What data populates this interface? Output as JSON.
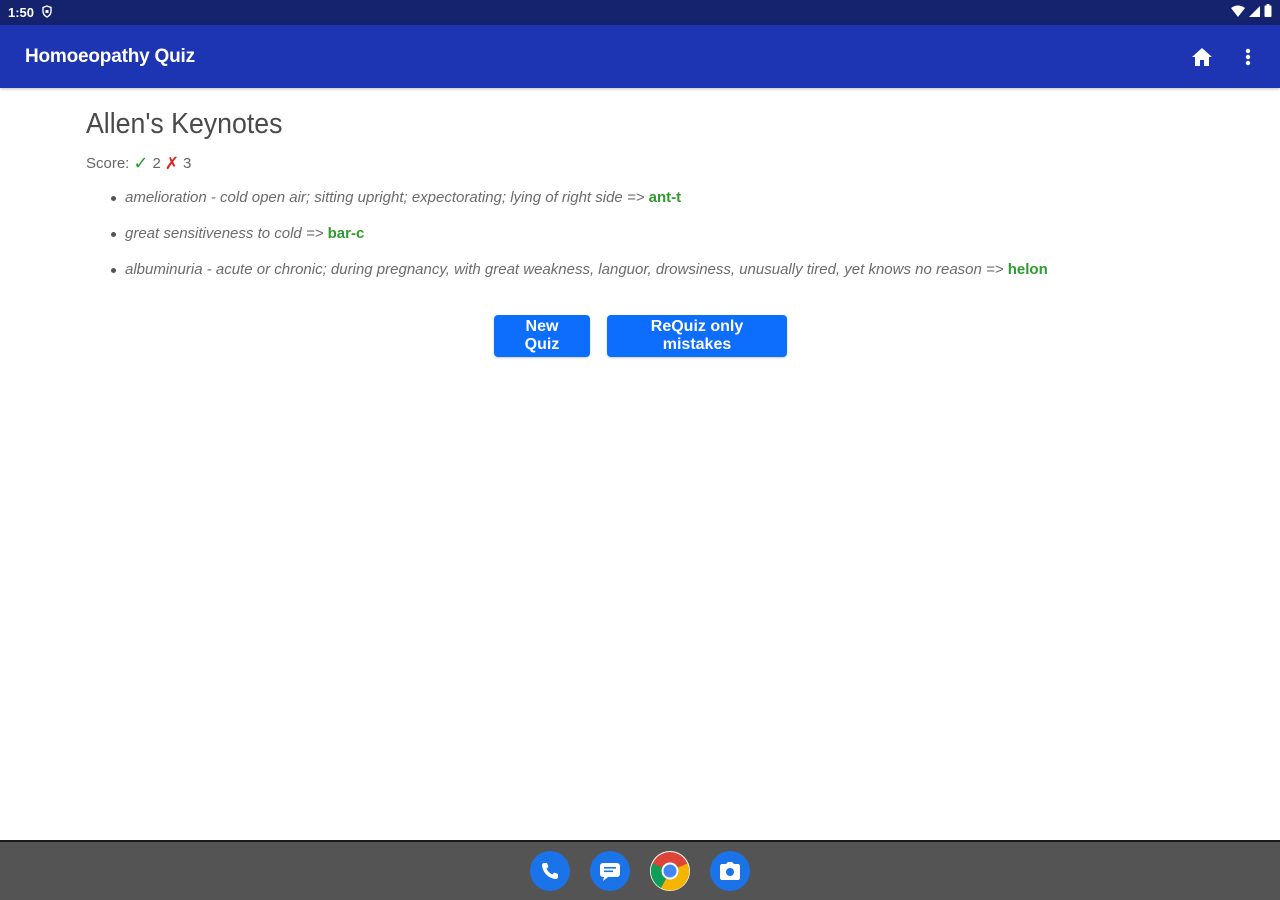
{
  "status_bar": {
    "time": "1:50"
  },
  "app_bar": {
    "title": "Homoeopathy Quiz",
    "home_icon": "home-icon",
    "menu_icon": "more-vert-icon"
  },
  "main": {
    "title": "Allen's Keynotes",
    "score": {
      "label": "Score:",
      "check_symbol": "✓",
      "correct": "2",
      "cross_symbol": "✗",
      "wrong": "3"
    },
    "items": [
      {
        "text": "amelioration - cold open air; sitting upright; expectorating; lying of right side",
        "arrow": "=>",
        "answer": "ant-t"
      },
      {
        "text": "great sensitiveness to cold",
        "arrow": "=>",
        "answer": "bar-c"
      },
      {
        "text": "albuminuria - acute or chronic; during pregnancy, with great weakness, languor, drowsiness, unusually tired, yet knows no reason",
        "arrow": "=>",
        "answer": "helon"
      }
    ],
    "buttons": {
      "new_quiz": "New Quiz",
      "requiz": "ReQuiz only mistakes"
    }
  },
  "dock": {
    "apps": [
      "phone-icon",
      "messages-icon",
      "chrome-icon",
      "camera-icon"
    ]
  },
  "colors": {
    "status_bar": "#15236e",
    "app_bar": "#1e35b3",
    "button": "#0d6efd",
    "correct": "#2e9b2e",
    "wrong": "#e0221e",
    "nav_bar": "#545454"
  }
}
